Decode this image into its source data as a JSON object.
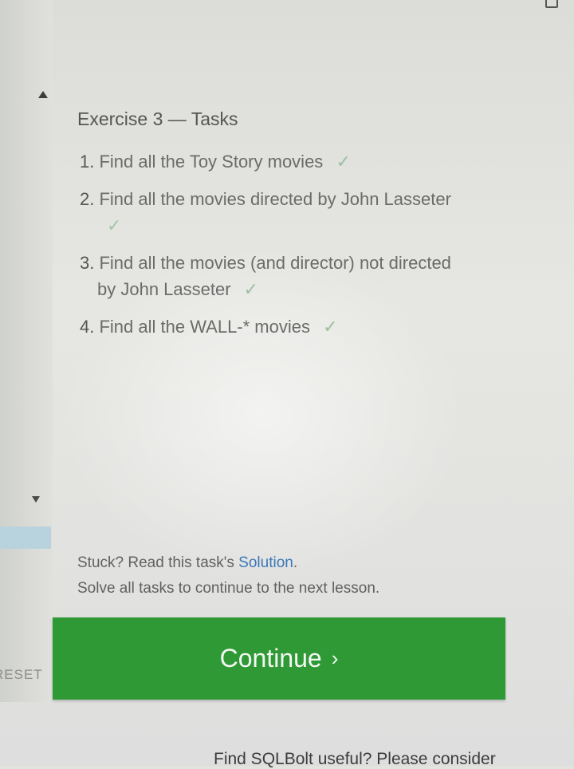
{
  "exercise": {
    "title": "Exercise 3 — Tasks",
    "tasks": [
      {
        "number": "1.",
        "line1": "Find all the Toy Story movies",
        "line2": "",
        "check": "✓",
        "check_on_new_line": false
      },
      {
        "number": "2.",
        "line1": "Find all the movies directed by John Lasseter",
        "line2": "",
        "check": "✓",
        "check_on_new_line": true
      },
      {
        "number": "3.",
        "line1": "Find all the movies (and director) not directed",
        "line2": "by John Lasseter",
        "check": "✓",
        "check_on_new_line": false
      },
      {
        "number": "4.",
        "line1": "Find all the WALL-* movies",
        "line2": "",
        "check": "✓",
        "check_on_new_line": false
      }
    ]
  },
  "help": {
    "stuck_prefix": "Stuck? Read this task's ",
    "solution_link": "Solution",
    "stuck_suffix": ".",
    "solve_note": "Solve all tasks to continue to the next lesson."
  },
  "buttons": {
    "continue_label": "Continue",
    "continue_chevron": "›",
    "reset_label": "RESET"
  },
  "footer": {
    "note": "Find SQLBolt useful? Please consider"
  },
  "colors": {
    "continue_bg": "#2f9a35",
    "link": "#3a78b8",
    "check": "#9fbf9f"
  }
}
